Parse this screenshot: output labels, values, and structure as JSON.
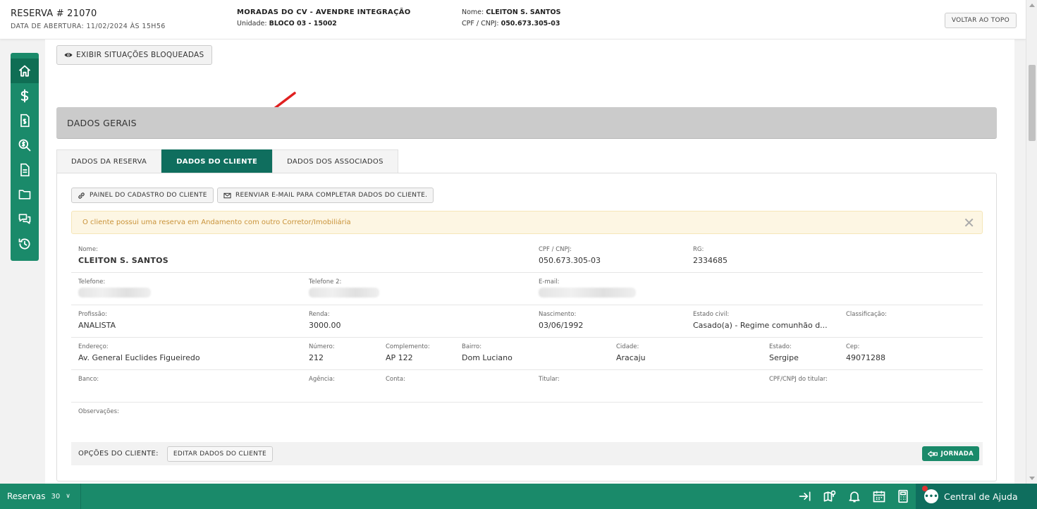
{
  "header": {
    "title": "RESERVA # 21070",
    "opened": "DATA DE ABERTURA: 11/02/2024 ÀS 15H56",
    "enterprise": "MORADAS DO CV - AVENDRE INTEGRAÇÃO",
    "unit_label": "Unidade:",
    "unit_value": "BLOCO 03 - 15002",
    "name_label": "Nome:",
    "name_value": "CLEITON S. SANTOS",
    "cpf_label": "CPF / CNPJ:",
    "cpf_value": "050.673.305-03",
    "back_top": "VOLTAR AO TOPO"
  },
  "sidebar": {
    "items": [
      {
        "icon": "home-icon",
        "active": true
      },
      {
        "icon": "dollar-icon"
      },
      {
        "icon": "invoice-icon"
      },
      {
        "icon": "search-money-icon"
      },
      {
        "icon": "document-icon"
      },
      {
        "icon": "folder-icon"
      },
      {
        "icon": "chat-icon"
      },
      {
        "icon": "history-icon"
      }
    ]
  },
  "exibir_button": "EXIBIR SITUAÇÕES BLOQUEADAS",
  "section_title": "DADOS GERAIS",
  "tabs": [
    {
      "label": "DADOS DA RESERVA"
    },
    {
      "label": "DADOS DO CLIENTE",
      "active": true
    },
    {
      "label": "DADOS DOS ASSOCIADOS"
    }
  ],
  "panel": {
    "btn_painel": "PAINEL DO CADASTRO DO CLIENTE",
    "btn_reenviar": "REENVIAR E-MAIL PARA COMPLETAR DADOS DO CLIENTE.",
    "alert": "O cliente possui uma reserva em Andamento com outro Corretor/Imobiliária",
    "alert_close": "✕",
    "fields": {
      "nome_label": "Nome:",
      "nome": "CLEITON S. SANTOS",
      "cpf_label": "CPF / CNPJ:",
      "cpf": "050.673.305-03",
      "rg_label": "RG:",
      "rg": "2334685",
      "tel_label": "Telefone:",
      "tel2_label": "Telefone 2:",
      "email_label": "E-mail:",
      "prof_label": "Profissão:",
      "prof": "ANALISTA",
      "renda_label": "Renda:",
      "renda": "3000.00",
      "nasc_label": "Nascimento:",
      "nasc": "03/06/1992",
      "civil_label": "Estado civil:",
      "civil": "Casado(a) - Regime comunhão d...",
      "class_label": "Classificação:",
      "end_label": "Endereço:",
      "end": "Av. General Euclides Figueiredo",
      "num_label": "Número:",
      "num": "212",
      "comp_label": "Complemento:",
      "comp": "AP 122",
      "bairro_label": "Bairro:",
      "bairro": "Dom Luciano",
      "cidade_label": "Cidade:",
      "cidade": "Aracaju",
      "estado_label": "Estado:",
      "estado": "Sergipe",
      "cep_label": "Cep:",
      "cep": "49071288",
      "banco_label": "Banco:",
      "agencia_label": "Agência:",
      "conta_label": "Conta:",
      "titular_label": "Titular:",
      "cpf_titular_label": "CPF/CNPJ do titular:",
      "obs_label": "Observações:"
    },
    "options_label": "OPÇÕES DO CLIENTE:",
    "edit_button": "EDITAR DADOS DO CLIENTE",
    "jornada": "JORNADA"
  },
  "bottom": {
    "reservas": "Reservas",
    "count": "30",
    "help": "Central de Ajuda"
  },
  "colors": {
    "brand_green": "#1a8a6a",
    "tab_active": "#0f6e5e",
    "alert_text": "#c9933a",
    "arrow": "#e02020"
  }
}
